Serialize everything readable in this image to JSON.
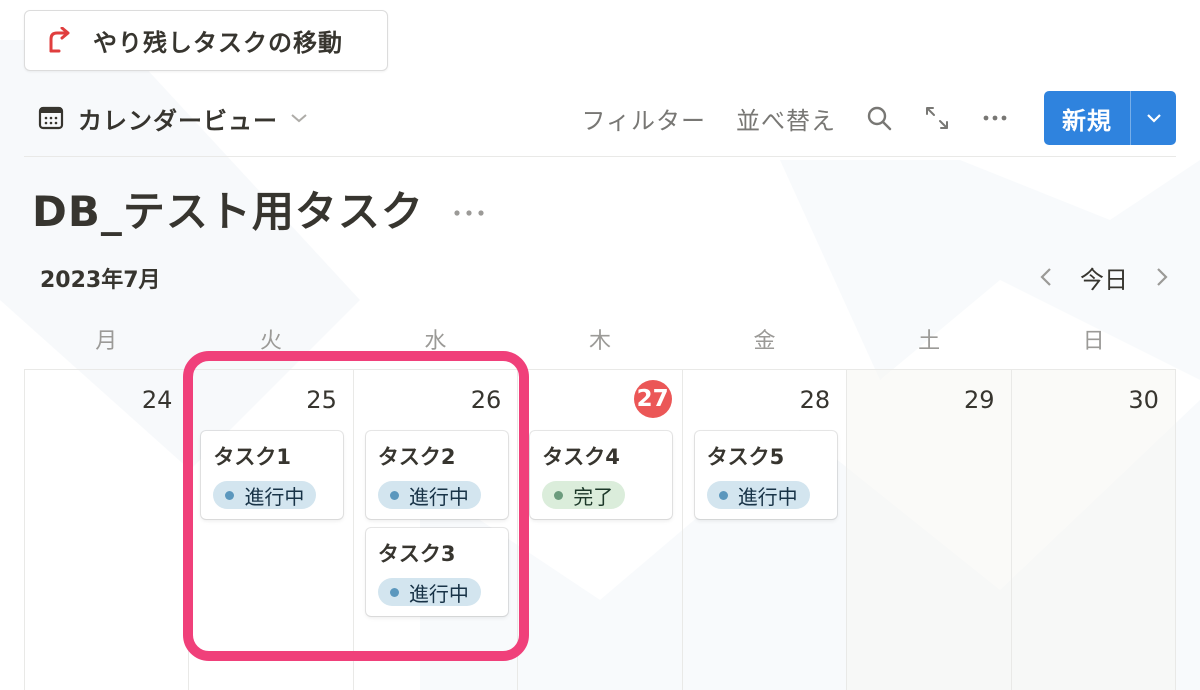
{
  "top_button": {
    "label": "やり残しタスクの移動",
    "icon": "redirect-arrow-icon",
    "icon_color": "#e03e3e"
  },
  "toolbar": {
    "view_label": "カレンダービュー",
    "filter_label": "フィルター",
    "sort_label": "並べ替え",
    "new_label": "新規",
    "accent_color": "#2f83de"
  },
  "database": {
    "title": "DB_テスト用タスク"
  },
  "calendar": {
    "month_label": "2023年7月",
    "today_label": "今日",
    "weekdays": [
      "月",
      "火",
      "水",
      "木",
      "金",
      "土",
      "日"
    ],
    "days": [
      {
        "num": "24",
        "tasks": []
      },
      {
        "num": "25",
        "tasks": [
          {
            "title": "タスク1",
            "status": "進行中"
          }
        ]
      },
      {
        "num": "26",
        "tasks": [
          {
            "title": "タスク2",
            "status": "進行中"
          },
          {
            "title": "タスク3",
            "status": "進行中"
          }
        ]
      },
      {
        "num": "27",
        "today": true,
        "tasks": [
          {
            "title": "タスク4",
            "status": "完了"
          }
        ]
      },
      {
        "num": "28",
        "tasks": [
          {
            "title": "タスク5",
            "status": "進行中"
          }
        ]
      },
      {
        "num": "29",
        "tasks": []
      },
      {
        "num": "30",
        "tasks": []
      }
    ],
    "today_color": "#eb5757",
    "highlight_color": "#f0407a"
  }
}
